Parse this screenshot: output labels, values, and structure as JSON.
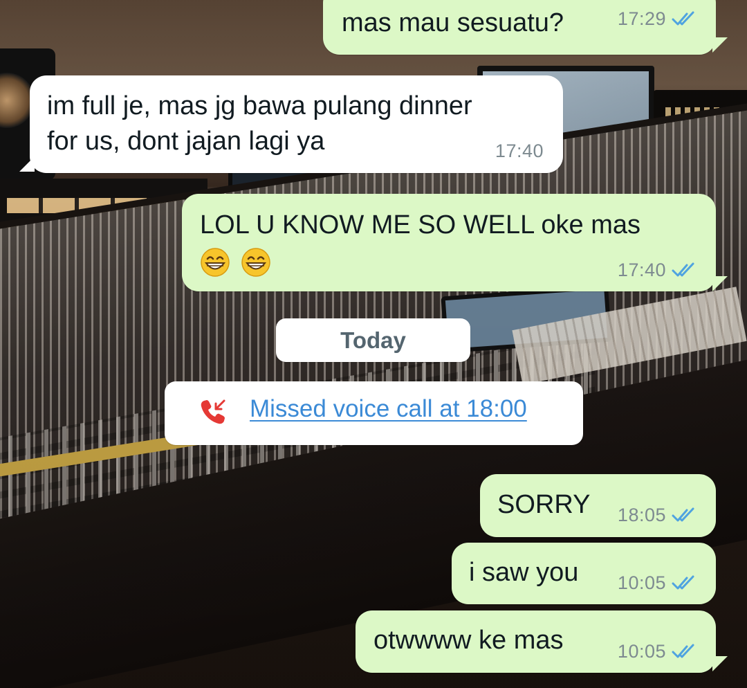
{
  "colors": {
    "outgoing_bubble": "#dcf8c6",
    "incoming_bubble": "#ffffff",
    "timestamp": "#7d8a90",
    "read_ticks": "#4fa3e0",
    "missed_call_icon": "#e53935",
    "missed_call_link": "#3b8ad6",
    "day_label": "#54656f"
  },
  "messages": [
    {
      "direction": "outgoing",
      "text": "mas mau sesuatu?",
      "time": "17:29",
      "status": "read"
    },
    {
      "direction": "incoming",
      "text_line1": "im full je, mas jg bawa pulang dinner",
      "text_line2": "for us, dont jajan lagi ya",
      "time": "17:40"
    },
    {
      "direction": "outgoing",
      "text": "LOL U KNOW ME SO WELL oke mas",
      "emojis": [
        "grinning-face-with-smiling-eyes-icon",
        "grinning-face-with-smiling-eyes-icon"
      ],
      "time": "17:40",
      "status": "read"
    },
    {
      "direction": "outgoing",
      "text": "SORRY",
      "time": "18:05",
      "status": "read"
    },
    {
      "direction": "outgoing",
      "text": "i saw you",
      "time": "10:05",
      "status": "read"
    },
    {
      "direction": "outgoing",
      "text": "otwwww ke mas",
      "time": "10:05",
      "status": "read"
    }
  ],
  "day_separator": "Today",
  "missed_call": {
    "icon": "missed-call-icon",
    "text": "Missed voice call at 18:00"
  },
  "background": "recording-studio-wallpaper"
}
